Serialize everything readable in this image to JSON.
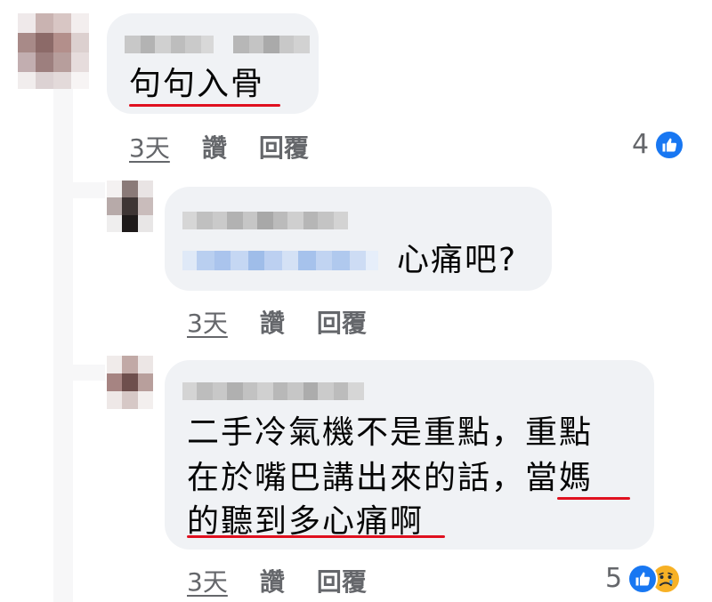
{
  "comments": [
    {
      "text": "句句入骨",
      "time": "3天",
      "like_label": "讚",
      "reply_label": "回覆",
      "reaction_count": "4",
      "reaction_icons": [
        "like-icon"
      ]
    },
    {
      "text": "心痛吧?",
      "time": "3天",
      "like_label": "讚",
      "reply_label": "回覆"
    },
    {
      "lines": [
        "二手冷氣機不是重點，重點",
        "在於嘴巴講出來的話，當媽",
        "的聽到多心痛啊"
      ],
      "time": "3天",
      "like_label": "讚",
      "reply_label": "回覆",
      "reaction_count": "5",
      "reaction_icons": [
        "like-icon",
        "sad-icon"
      ]
    }
  ],
  "colors": {
    "bubble": "#f0f2f5",
    "secondary_text": "#65676b",
    "underline": "#e0101f",
    "like_blue": "#1877f2",
    "sad_yellow": "#f7b125"
  }
}
